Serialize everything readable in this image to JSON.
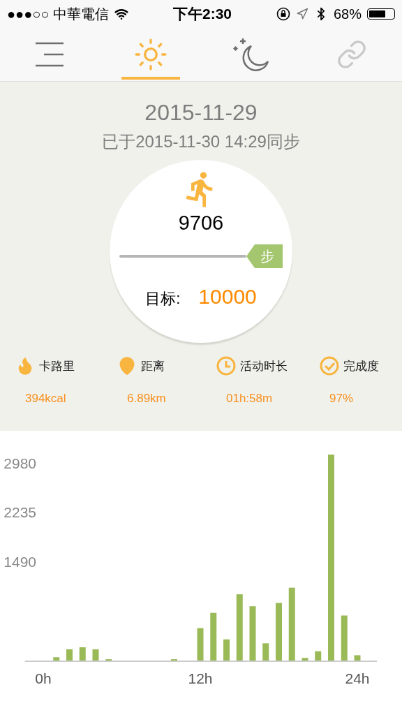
{
  "status_bar": {
    "carrier": "●●●○○ 中華電信",
    "time": "下午2:30",
    "battery": "68%"
  },
  "nav_tabs": [
    {
      "kind": "menu",
      "selected": false
    },
    {
      "kind": "day",
      "selected": true
    },
    {
      "kind": "night",
      "selected": false
    },
    {
      "kind": "link",
      "selected": false
    }
  ],
  "summary": {
    "date": "2015-11-29",
    "synced": "已于2015-11-30 14:29同步",
    "steps": "9706",
    "unit": "步",
    "goal_label": "目标:",
    "goal": "10000"
  },
  "stats": [
    {
      "kind": "calories",
      "label": "卡路里",
      "value": "394kcal"
    },
    {
      "kind": "distance",
      "label": "距离",
      "value": "6.89km"
    },
    {
      "kind": "duration",
      "label": "活动时长",
      "value": "01h:58m"
    },
    {
      "kind": "completion",
      "label": "完成度",
      "value": "97%"
    }
  ],
  "chart": {
    "chart_data": {
      "type": "bar",
      "x": [
        1,
        2,
        3,
        4,
        5,
        10,
        12,
        13,
        14,
        15,
        16,
        17,
        18,
        19,
        20,
        21,
        22,
        23,
        24
      ],
      "series": [
        {
          "color": "#9aba58",
          "values": [
            50,
            170,
            200,
            170,
            20,
            20,
            490,
            720,
            320,
            1000,
            820,
            260,
            870,
            1100,
            40,
            140,
            3110,
            680,
            80
          ]
        }
      ],
      "xlim": [
        -1.4,
        25.5
      ],
      "ylim": [
        0,
        3110
      ],
      "yticks": [
        1490,
        2235,
        2980
      ],
      "xticks": [
        {
          "value": 0,
          "label": "0h"
        },
        {
          "value": 12,
          "label": "12h"
        },
        {
          "value": 24,
          "label": "24h"
        }
      ]
    }
  }
}
